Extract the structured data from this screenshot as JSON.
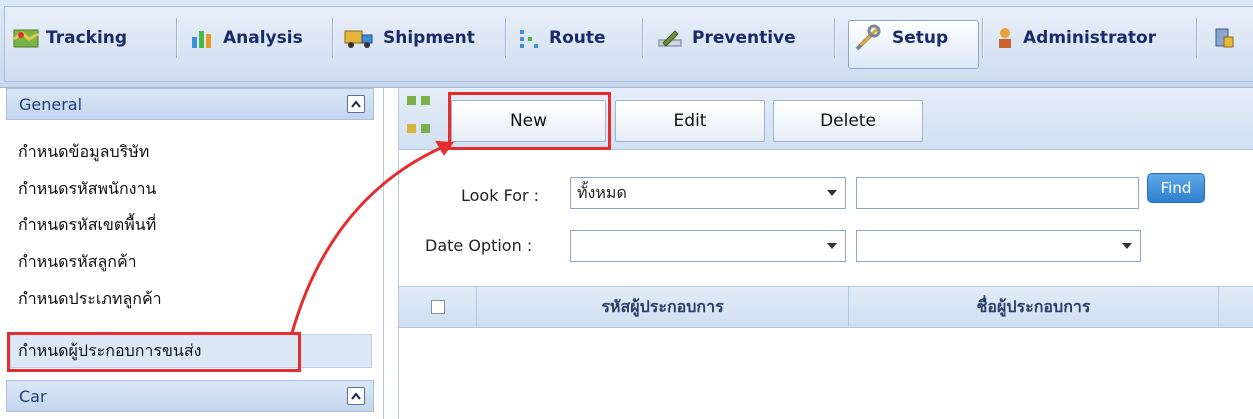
{
  "nav": {
    "items": [
      {
        "label": "Tracking",
        "icon": "map-icon"
      },
      {
        "label": "Analysis",
        "icon": "bar-chart-icon"
      },
      {
        "label": "Shipment",
        "icon": "truck-icon"
      },
      {
        "label": "Route",
        "icon": "route-icon"
      },
      {
        "label": "Preventive",
        "icon": "wrench-pencil-icon"
      },
      {
        "label": "Setup",
        "icon": "tools-icon"
      },
      {
        "label": "Administrator",
        "icon": "user-icon"
      }
    ],
    "active": "Setup"
  },
  "sidebar": {
    "general_title": "General",
    "items": [
      "กำหนดข้อมูลบริษัท",
      "กำหนดรหัสพนักงาน",
      "กำหนดรหัสเขตพื้นที่",
      "กำหนดรหัสลูกค้า",
      "กำหนดประเภทลูกค้า",
      "กำหนดผู้ประกอบการขนส่ง"
    ],
    "selected_index": 5,
    "car_title": "Car"
  },
  "toolbar": {
    "new_label": "New",
    "edit_label": "Edit",
    "delete_label": "Delete"
  },
  "search": {
    "look_for_label": "Look For :",
    "look_for_value": "ทั้งหมด",
    "look_for_text": "",
    "find_label": "Find",
    "date_option_label": "Date Option :",
    "date_option_value": "",
    "date_option_value2": ""
  },
  "grid": {
    "columns": [
      "รหัสผู้ประกอบการ",
      "ชื่อผู้ประกอบการ"
    ]
  },
  "colors": {
    "accent_red": "#e52d2d",
    "nav_text": "#1b2a6b",
    "find_button": "#2f7fd0"
  }
}
